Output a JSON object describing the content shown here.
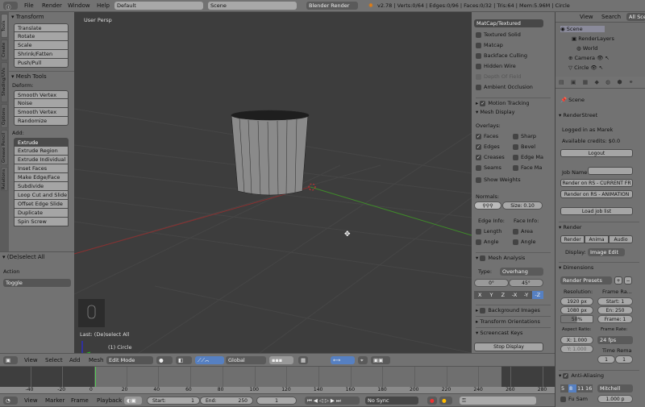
{
  "topbar": {
    "menus": [
      "File",
      "Render",
      "Window",
      "Help"
    ],
    "layout": "Default",
    "scene": "Scene",
    "engine": "Blender Render",
    "stats": "v2.78 | Verts:0/64 | Edges:0/96 | Faces:0/32 | Tris:64 | Mem:5.96M | Circle"
  },
  "tool_tabs": [
    "Tools",
    "Create",
    "Shading/UVs",
    "Options",
    "Grease Pencil",
    "Relations"
  ],
  "toolshelf": {
    "transform_title": "Transform",
    "transform": [
      "Translate",
      "Rotate",
      "Scale",
      "Shrink/Fatten",
      "Push/Pull"
    ],
    "mesh_tools_title": "Mesh Tools",
    "deform_label": "Deform:",
    "deform": [
      "Smooth Vertex",
      "Noise",
      "Smooth Vertex",
      "Randomize"
    ],
    "add_label": "Add:",
    "extrude": "Extrude",
    "add": [
      "Extrude Region",
      "Extrude Individual",
      "Inset Faces",
      "Make Edge/Face",
      "Subdivide",
      "Loop Cut and Slide",
      "Offset Edge Slide",
      "Duplicate",
      "Spin          Screw"
    ]
  },
  "redo": {
    "title": "(De)select All",
    "action_label": "Action",
    "action_value": "Toggle"
  },
  "viewport": {
    "view_name": "User Persp",
    "last_op": "Last: (De)select All",
    "object": "(1) Circle"
  },
  "npanel": {
    "shading_select": "MatCap/Textured",
    "shading": [
      "Textured Solid",
      "Matcap",
      "Backface Culling",
      "Hidden Wire",
      "Depth Of Field",
      "Ambient Occlusion"
    ],
    "motion_tracking": "Motion Tracking",
    "mesh_display": "Mesh Display",
    "overlays": "Overlays:",
    "overlay_left": [
      "Faces",
      "Edges",
      "Creases",
      "Seams"
    ],
    "overlay_right": [
      "Sharp",
      "Bevel",
      "Edge Ma",
      "Face Ma"
    ],
    "show_weights": "Show Weights",
    "normals": "Normals:",
    "size": "Size: 0.10",
    "edge_info": "Edge Info:",
    "face_info": "Face Info:",
    "edge_items": [
      "Length",
      "Angle"
    ],
    "face_items": [
      "Area",
      "Angle"
    ],
    "mesh_analysis": "Mesh Analysis",
    "type_label": "Type:",
    "type_value": "Overhang",
    "range_min": "0°",
    "range_max": "45°",
    "axes": [
      "X",
      "Y",
      "Z",
      "-X",
      "-Y",
      "-Z"
    ],
    "background_images": "Background Images",
    "transform_orientations": "Transform Orientations",
    "screencast_keys": "Screencast Keys",
    "stop_display": "Stop Display"
  },
  "outliner": {
    "view": "View",
    "search": "Search",
    "filter": "All Scenes",
    "items": [
      "Scene",
      "RenderLayers",
      "World",
      "Camera",
      "Circle"
    ]
  },
  "properties": {
    "scene": "Scene",
    "renderstreet": "RenderStreet",
    "logged_in": "Logged in as Marek",
    "credits": "Available credits: $0.0",
    "logout": "Logout",
    "job_name": "Job Name",
    "render_current": "Render on RS - CURRENT FR",
    "render_anim": "Render on RS - ANIMATION",
    "load_job": "Load job list",
    "render": "Render",
    "render_btns": [
      "Render",
      "Anima",
      "Audio"
    ],
    "display_label": "Display:",
    "display_value": "Image Edit",
    "dimensions": "Dimensions",
    "presets": "Render Presets",
    "resolution": "Resolution:",
    "res_x": "1920 px",
    "res_y": "1080 px",
    "res_pct": "50%",
    "frame_range": "Frame Ra...",
    "start": "Start: 1",
    "end": "En: 250",
    "frame": "Frame: 1",
    "aspect": "Aspect Ratio:",
    "asp_x": "X: 1.000",
    "asp_y": "Y: 1.000",
    "frame_rate": "Frame Rate:",
    "fps": "24 fps",
    "time_remap": "Time Rema",
    "remap_a": "1",
    "remap_b": "1",
    "anti_aliasing": "Anti-Aliasing",
    "aa_samples": [
      "5",
      "8",
      "11",
      "16"
    ],
    "filter": "Mitchell",
    "full_sample": "Fu  Sam",
    "filter_size": "1.000 p"
  },
  "view3d_header": {
    "menus": [
      "View",
      "Select",
      "Add",
      "Mesh"
    ],
    "mode": "Edit Mode",
    "orientation": "Global"
  },
  "timeline": {
    "ticks": [
      "-40",
      "-20",
      "0",
      "20",
      "40",
      "60",
      "80",
      "100",
      "120",
      "140",
      "160",
      "180",
      "200",
      "220",
      "240",
      "260",
      "280"
    ],
    "current_frame": 0,
    "menus": [
      "View",
      "Marker",
      "Frame",
      "Playback"
    ],
    "start": "Start:",
    "start_val": "1",
    "end": "End:",
    "end_val": "250",
    "frame": "1",
    "sync": "No Sync"
  }
}
